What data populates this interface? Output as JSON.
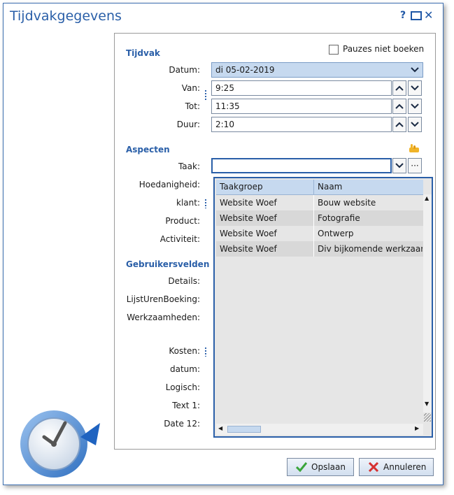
{
  "window": {
    "title": "Tijdvakgegevens",
    "help": "?"
  },
  "tijdvak": {
    "section": "Tijdvak",
    "pauzes_label": "Pauzes niet boeken",
    "datum_label": "Datum:",
    "datum_value": "di 05-02-2019",
    "van_label": "Van:",
    "van_value": "9:25",
    "tot_label": "Tot:",
    "tot_value": "11:35",
    "duur_label": "Duur:",
    "duur_value": "2:10"
  },
  "aspecten": {
    "section": "Aspecten",
    "taak_label": "Taak:",
    "taak_value": "",
    "hoedanigheid_label": "Hoedanigheid:",
    "klant_label": "klant:",
    "product_label": "Product:",
    "activiteit_label": "Activiteit:"
  },
  "gebruikersvelden": {
    "section": "Gebruikersvelden",
    "details_label": "Details:",
    "lijst_label": "LijstUrenBoeking:",
    "werk_label": "Werkzaamheden:",
    "kosten_label": "Kosten:",
    "datum_label": "datum:",
    "logisch_label": "Logisch:",
    "text1_label": "Text 1:",
    "date12_label": "Date 12:"
  },
  "dropdown": {
    "columns": [
      "Taakgroep",
      "Naam"
    ],
    "rows": [
      {
        "taakgroep": "Website Woef",
        "naam": "Bouw website"
      },
      {
        "taakgroep": "Website Woef",
        "naam": "Fotografie"
      },
      {
        "taakgroep": "Website Woef",
        "naam": "Ontwerp"
      },
      {
        "taakgroep": "Website Woef",
        "naam": "Div bijkomende werkzaam"
      }
    ]
  },
  "buttons": {
    "save": "Opslaan",
    "cancel": "Annuleren"
  },
  "colors": {
    "accent": "#2a5fa8",
    "selected_field": "#c6d9ef"
  }
}
